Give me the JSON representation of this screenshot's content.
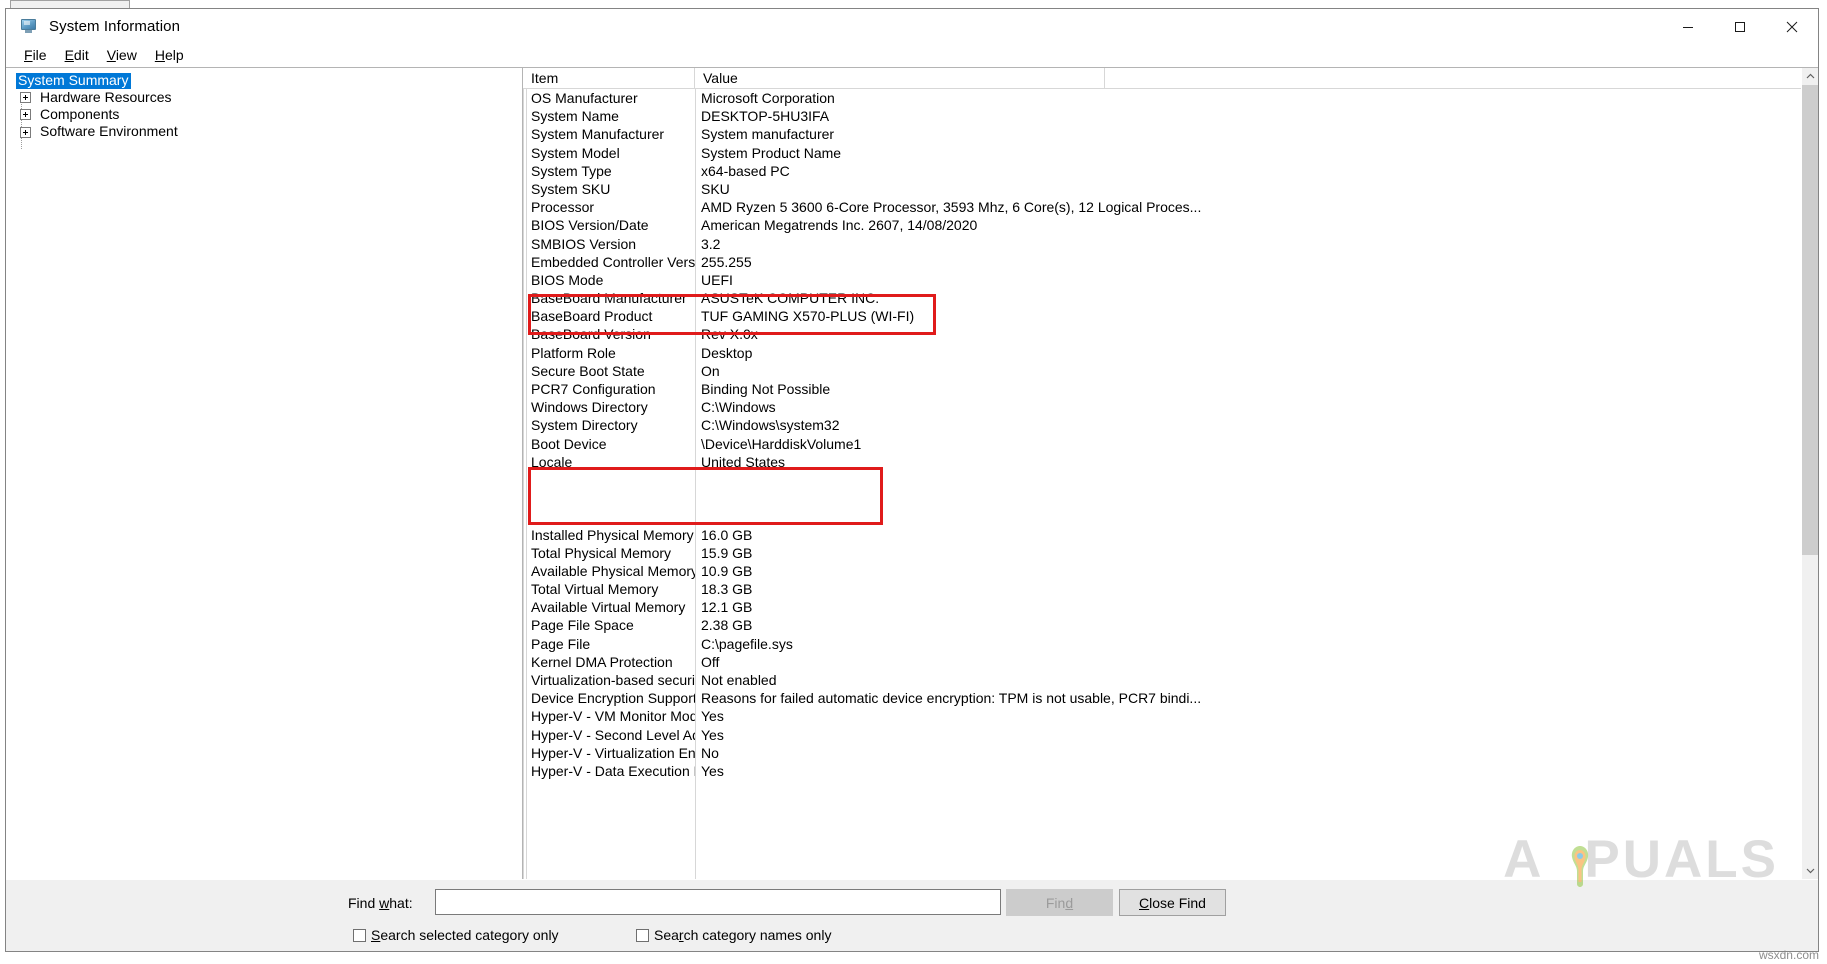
{
  "window": {
    "title": "System Information",
    "icon": "system-information-icon",
    "controls": {
      "minimize": "minimize-icon",
      "maximize": "maximize-icon",
      "close": "close-icon"
    }
  },
  "menubar": {
    "items": [
      {
        "label": "File",
        "mnemonic": "F"
      },
      {
        "label": "Edit",
        "mnemonic": "E"
      },
      {
        "label": "View",
        "mnemonic": "V"
      },
      {
        "label": "Help",
        "mnemonic": "H"
      }
    ]
  },
  "tree": {
    "items": [
      {
        "label": "System Summary",
        "expandable": false,
        "selected": true
      },
      {
        "label": "Hardware Resources",
        "expandable": true,
        "selected": false
      },
      {
        "label": "Components",
        "expandable": true,
        "selected": false
      },
      {
        "label": "Software Environment",
        "expandable": true,
        "selected": false
      }
    ]
  },
  "list": {
    "columns": [
      {
        "key": "item",
        "label": "Item"
      },
      {
        "key": "value",
        "label": "Value"
      }
    ],
    "rows": [
      {
        "item": "OS Manufacturer",
        "value": "Microsoft Corporation"
      },
      {
        "item": "System Name",
        "value": "DESKTOP-5HU3IFA"
      },
      {
        "item": "System Manufacturer",
        "value": "System manufacturer"
      },
      {
        "item": "System Model",
        "value": "System Product Name"
      },
      {
        "item": "System Type",
        "value": "x64-based PC"
      },
      {
        "item": "System SKU",
        "value": "SKU"
      },
      {
        "item": "Processor",
        "value": "AMD Ryzen 5 3600 6-Core Processor, 3593 Mhz, 6 Core(s), 12 Logical Proces..."
      },
      {
        "item": "BIOS Version/Date",
        "value": "American Megatrends Inc. 2607, 14/08/2020"
      },
      {
        "item": "SMBIOS Version",
        "value": "3.2"
      },
      {
        "item": "Embedded Controller Version",
        "value": "255.255"
      },
      {
        "item": "BIOS Mode",
        "value": "UEFI"
      },
      {
        "item": "BaseBoard Manufacturer",
        "value": "ASUSTeK COMPUTER INC."
      },
      {
        "item": "BaseBoard Product",
        "value": "TUF GAMING X570-PLUS (WI-FI)"
      },
      {
        "item": "BaseBoard Version",
        "value": "Rev X.0x"
      },
      {
        "item": "Platform Role",
        "value": "Desktop"
      },
      {
        "item": "Secure Boot State",
        "value": "On"
      },
      {
        "item": "PCR7 Configuration",
        "value": "Binding Not Possible"
      },
      {
        "item": "Windows Directory",
        "value": "C:\\Windows"
      },
      {
        "item": "System Directory",
        "value": "C:\\Windows\\system32"
      },
      {
        "item": "Boot Device",
        "value": "\\Device\\HarddiskVolume1"
      },
      {
        "item": "Locale",
        "value": "United States"
      },
      {
        "item": "",
        "value": ""
      },
      {
        "item": "",
        "value": ""
      },
      {
        "item": "",
        "value": ""
      },
      {
        "item": "Installed Physical Memory (RAM)",
        "value": "16.0 GB"
      },
      {
        "item": "Total Physical Memory",
        "value": "15.9 GB"
      },
      {
        "item": "Available Physical Memory",
        "value": "10.9 GB"
      },
      {
        "item": "Total Virtual Memory",
        "value": "18.3 GB"
      },
      {
        "item": "Available Virtual Memory",
        "value": "12.1 GB"
      },
      {
        "item": "Page File Space",
        "value": "2.38 GB"
      },
      {
        "item": "Page File",
        "value": "C:\\pagefile.sys"
      },
      {
        "item": "Kernel DMA Protection",
        "value": "Off"
      },
      {
        "item": "Virtualization-based security",
        "value": "Not enabled"
      },
      {
        "item": "Device Encryption Support",
        "value": "Reasons for failed automatic device encryption: TPM is not usable, PCR7 bindi..."
      },
      {
        "item": "Hyper-V - VM Monitor Mode E...",
        "value": "Yes"
      },
      {
        "item": "Hyper-V - Second Level Addres...",
        "value": "Yes"
      },
      {
        "item": "Hyper-V - Virtualization Enable...",
        "value": "No"
      },
      {
        "item": "Hyper-V - Data Execution Prote...",
        "value": "Yes"
      }
    ]
  },
  "annotations": {
    "highlight_color": "#e01b1b",
    "boxes": [
      {
        "name": "baseboard-highlight",
        "label": "BaseBoard rows highlight"
      },
      {
        "name": "empty-rows-highlight",
        "label": "Missing rows highlight"
      }
    ]
  },
  "findbar": {
    "find_label": "Find what:",
    "find_label_mnemonic": "w",
    "find_value": "",
    "find_placeholder": "",
    "find_button": "Find",
    "find_button_mnemonic": "d",
    "close_find_button": "Close Find",
    "close_find_mnemonic": "C",
    "checkboxes": [
      {
        "label": "Search selected category only",
        "mnemonic": "S",
        "checked": false
      },
      {
        "label": "Search category names only",
        "mnemonic": "c",
        "checked": false
      }
    ]
  },
  "scrollbar": {
    "up_arrow": "chevron-up-icon",
    "down_arrow": "chevron-down-icon"
  },
  "watermarks": {
    "brand": "PUALS",
    "brand_initial": "A",
    "source": "wsxdn.com"
  }
}
